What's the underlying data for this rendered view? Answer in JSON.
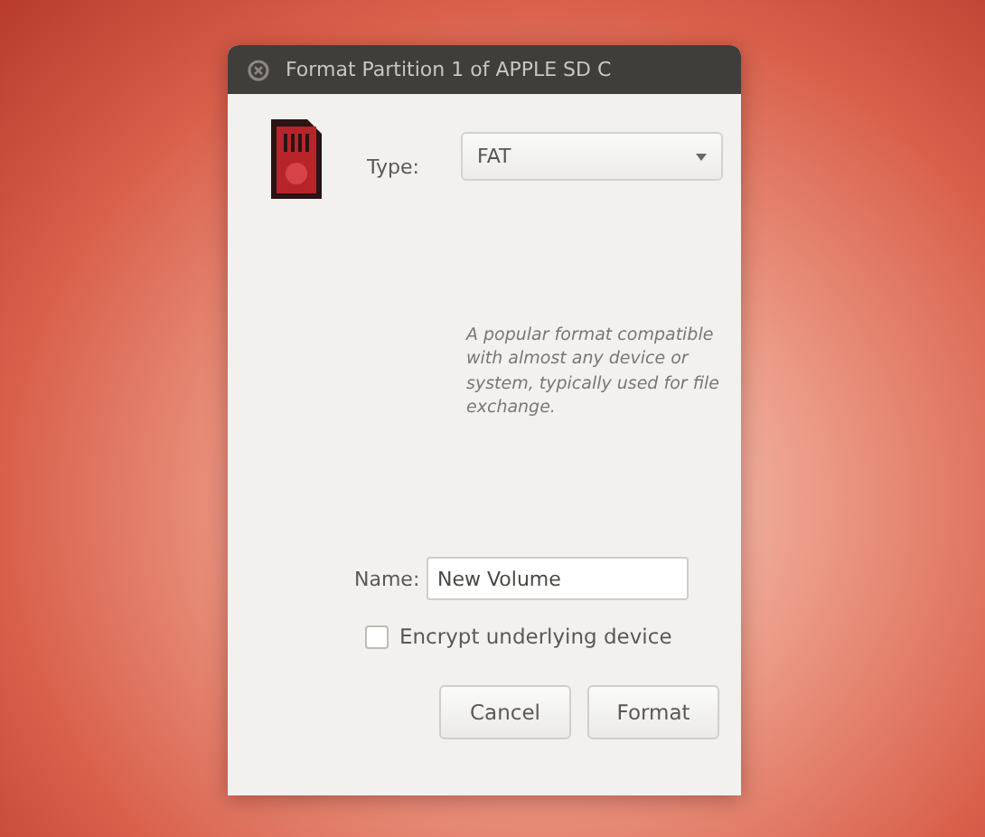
{
  "window": {
    "title": "Format Partition 1 of APPLE SD C"
  },
  "type": {
    "label": "Type:",
    "value": "FAT"
  },
  "description": "A popular format compatible with almost any device or system, typically used for file exchange.",
  "name": {
    "label": "Name:",
    "value": "New Volume"
  },
  "encrypt": {
    "label": "Encrypt underlying device",
    "checked": false
  },
  "buttons": [
    {
      "label": "Cancel"
    },
    {
      "label": "Format"
    }
  ]
}
